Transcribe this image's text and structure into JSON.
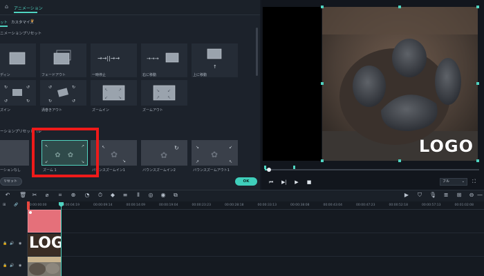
{
  "header": {
    "tab_label": "アニメーション",
    "home_icon": "home-icon"
  },
  "subtabs": {
    "preset": "ット",
    "customize": "カスタマイズ"
  },
  "sections": {
    "animation_presets": "ニメーションプリセット",
    "motion_presets": "ーションプリセット（レ"
  },
  "row1": [
    {
      "label": "ディン"
    },
    {
      "label": "フェードアウト"
    },
    {
      "label": "一時停止"
    },
    {
      "label": "右に移動"
    },
    {
      "label": "上に移動"
    }
  ],
  "row2": [
    {
      "label": "ズイン"
    },
    {
      "label": "渦巻きアウト"
    },
    {
      "label": "ズームイン"
    },
    {
      "label": "ズームアウト"
    }
  ],
  "row3": [
    {
      "label": "ーションなし"
    },
    {
      "label": "ズーム 1"
    },
    {
      "label": "バウンスズームイン1"
    },
    {
      "label": "バウンスズームイン2"
    },
    {
      "label": "バウンスズームアウト1"
    }
  ],
  "bottom": {
    "preset_button": "リセット",
    "ok_button": "OK"
  },
  "preview": {
    "logo_text": "LOGO",
    "quality": "フル",
    "seek_progress": 0.01
  },
  "timeline": {
    "timestamps": [
      "00:00:00:00",
      "00:00:04:19",
      "00:00:09:14",
      "00:00:14:09",
      "00:00:19:04",
      "00:00:23:23",
      "00:00:28:18",
      "00:00:33:13",
      "00:00:38:08",
      "00:00:43:04",
      "00:00:47:23",
      "00:00:52:18",
      "00:00:57:13",
      "00:01:02:08",
      "00:01:06:28"
    ]
  },
  "colors": {
    "accent": "#4fd4c1",
    "highlight_box": "#ef1a1a",
    "ok_button": "#3fcfbb"
  }
}
